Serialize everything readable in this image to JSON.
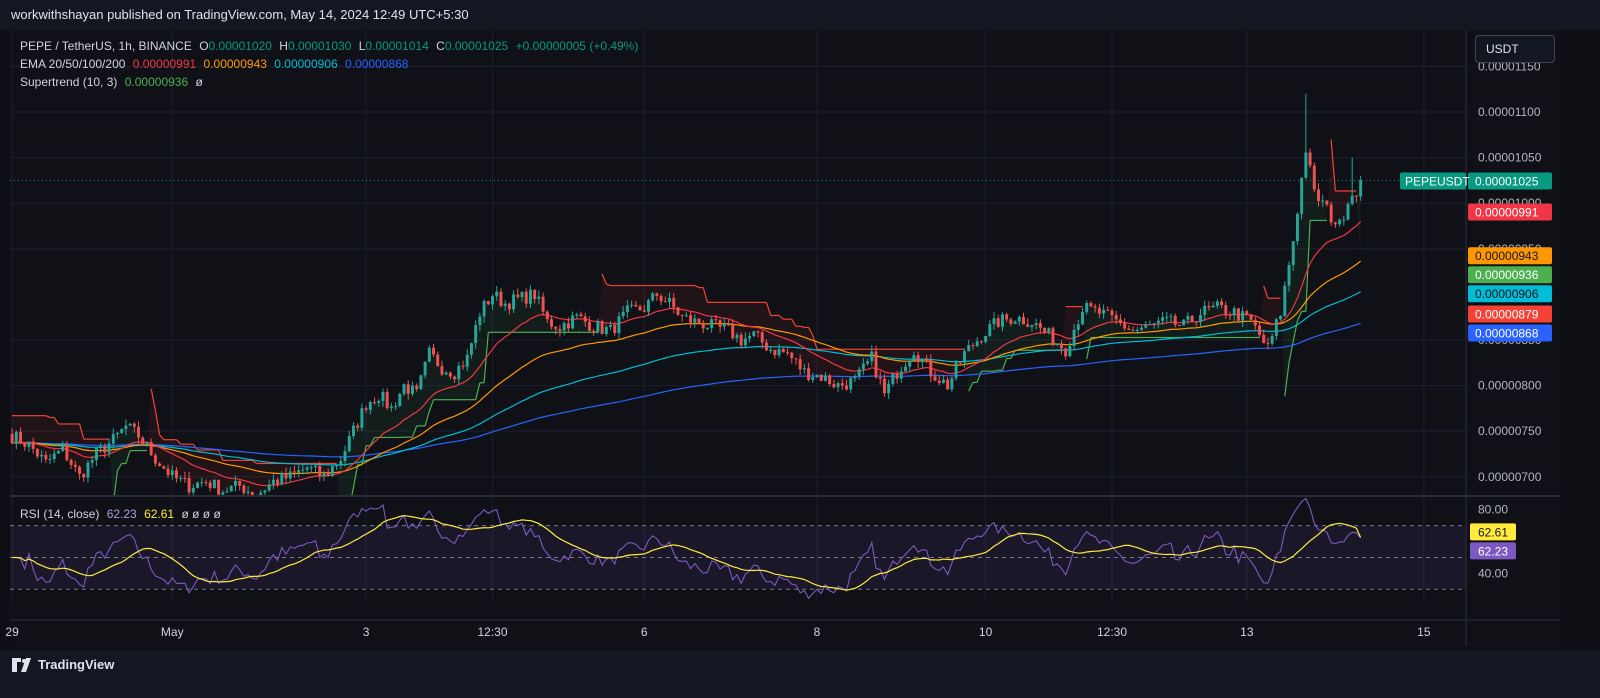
{
  "header": {
    "published": "workwithshayan published on TradingView.com, May 14, 2024 12:49 UTC+5:30"
  },
  "toolbar": {
    "currency_button": "USDT"
  },
  "brand": {
    "name": "TradingView"
  },
  "legend": {
    "symbol": "PEPE / TetherUS, 1h, BINANCE",
    "o_label": "O",
    "o_value": "0.00001020",
    "h_label": "H",
    "h_value": "0.00001030",
    "l_label": "L",
    "l_value": "0.00001014",
    "c_label": "C",
    "c_value": "0.00001025",
    "change": "+0.00000005 (+0.49%)",
    "ema_label": "EMA 20/50/100/200",
    "ema20": "0.00000991",
    "ema50": "0.00000943",
    "ema100": "0.00000906",
    "ema200": "0.00000868",
    "st_label": "Supertrend (10, 3)",
    "st_value": "0.00000936",
    "st_extra": "ø",
    "rsi_label": "RSI (14, close)",
    "rsi_value": "62.23",
    "rsi_ma": "62.61",
    "rsi_extra": "ø ø ø ø"
  },
  "colors": {
    "up": "#26a69a",
    "down": "#ef5350",
    "ema20": "#f23645",
    "ema50": "#ff9800",
    "ema100": "#00bcd4",
    "ema200": "#2962ff",
    "st_up": "#4caf50",
    "st_down": "#f44336",
    "rsi": "#7e57c2",
    "rsi_ma": "#ffeb3b",
    "price_label": "#089981"
  },
  "chart_data": {
    "type": "candlestick",
    "price_axis": {
      "ticks": [
        "0.00001150",
        "0.00001100",
        "0.00001050",
        "0.00001000",
        "0.00000950",
        "0.00000850",
        "0.00000800",
        "0.00000750",
        "0.00000700"
      ],
      "tick_values": [
        1.15e-05,
        1.1e-05,
        1.05e-05,
        1e-05,
        9.5e-06,
        8.5e-06,
        8e-06,
        7.5e-06,
        7e-06
      ],
      "ylim": [
        6.8e-06,
        1.19e-05
      ]
    },
    "price_labels": [
      {
        "name": "PEPEUSDT",
        "text": "0.00001025",
        "value": 1.025e-05,
        "color": "#089981"
      },
      {
        "text": "0.00000991",
        "value": 9.91e-06,
        "color": "#f23645"
      },
      {
        "text": "0.00000943",
        "value": 9.43e-06,
        "color": "#ff9800"
      },
      {
        "text": "0.00000936",
        "value": 9.36e-06,
        "color": "#4caf50"
      },
      {
        "text": "0.00000906",
        "value": 9.06e-06,
        "color": "#00bcd4"
      },
      {
        "text": "0.00000879",
        "value": 8.79e-06,
        "color": "#f44336"
      },
      {
        "text": "0.00000868",
        "value": 8.68e-06,
        "color": "#2962ff"
      }
    ],
    "time_axis": {
      "labels": [
        "29",
        "May",
        "3",
        "12:30",
        "6",
        "8",
        "10",
        "12:30",
        "13",
        "15"
      ],
      "label_hours": [
        0,
        38,
        84,
        114,
        150,
        191,
        231,
        261,
        293,
        335
      ]
    },
    "current_hour": 320,
    "close_anchors": [
      [
        0,
        7.45e-06
      ],
      [
        4,
        7.35e-06
      ],
      [
        8,
        7.15e-06
      ],
      [
        12,
        7.3e-06
      ],
      [
        16,
        7e-06
      ],
      [
        20,
        7.25e-06
      ],
      [
        24,
        7.4e-06
      ],
      [
        27,
        7.55e-06
      ],
      [
        30,
        7.45e-06
      ],
      [
        34,
        7.2e-06
      ],
      [
        38,
        7e-06
      ],
      [
        42,
        6.9e-06
      ],
      [
        46,
        6.95e-06
      ],
      [
        50,
        6.85e-06
      ],
      [
        54,
        6.9e-06
      ],
      [
        58,
        6.8e-06
      ],
      [
        62,
        6.95e-06
      ],
      [
        66,
        7e-06
      ],
      [
        70,
        7.1e-06
      ],
      [
        74,
        7e-06
      ],
      [
        78,
        7.2e-06
      ],
      [
        81,
        7.5e-06
      ],
      [
        84,
        7.8e-06
      ],
      [
        87,
        7.9e-06
      ],
      [
        90,
        7.75e-06
      ],
      [
        93,
        8e-06
      ],
      [
        96,
        7.9e-06
      ],
      [
        99,
        8.35e-06
      ],
      [
        102,
        8.2e-06
      ],
      [
        105,
        8.15e-06
      ],
      [
        108,
        8.3e-06
      ],
      [
        111,
        8.8e-06
      ],
      [
        114,
        9e-06
      ],
      [
        117,
        8.9e-06
      ],
      [
        120,
        8.95e-06
      ],
      [
        124,
        9e-06
      ],
      [
        127,
        8.7e-06
      ],
      [
        130,
        8.65e-06
      ],
      [
        134,
        8.75e-06
      ],
      [
        138,
        8.65e-06
      ],
      [
        142,
        8.6e-06
      ],
      [
        146,
        8.8e-06
      ],
      [
        150,
        8.85e-06
      ],
      [
        153,
        9e-06
      ],
      [
        156,
        8.9e-06
      ],
      [
        159,
        8.75e-06
      ],
      [
        162,
        8.7e-06
      ],
      [
        166,
        8.65e-06
      ],
      [
        170,
        8.6e-06
      ],
      [
        173,
        8.5e-06
      ],
      [
        176,
        8.55e-06
      ],
      [
        180,
        8.4e-06
      ],
      [
        184,
        8.35e-06
      ],
      [
        188,
        8.15e-06
      ],
      [
        192,
        8.1e-06
      ],
      [
        196,
        8e-06
      ],
      [
        200,
        8.05e-06
      ],
      [
        204,
        8.3e-06
      ],
      [
        207,
        7.9e-06
      ],
      [
        210,
        8.15e-06
      ],
      [
        214,
        8.4e-06
      ],
      [
        218,
        8.15e-06
      ],
      [
        222,
        8e-06
      ],
      [
        226,
        8.35e-06
      ],
      [
        230,
        8.55e-06
      ],
      [
        234,
        8.7e-06
      ],
      [
        238,
        8.75e-06
      ],
      [
        242,
        8.7e-06
      ],
      [
        246,
        8.55e-06
      ],
      [
        250,
        8.4e-06
      ],
      [
        254,
        8.85e-06
      ],
      [
        258,
        8.8e-06
      ],
      [
        262,
        8.7e-06
      ],
      [
        266,
        8.6e-06
      ],
      [
        270,
        8.65e-06
      ],
      [
        274,
        8.7e-06
      ],
      [
        278,
        8.65e-06
      ],
      [
        282,
        8.8e-06
      ],
      [
        286,
        8.85e-06
      ],
      [
        290,
        8.8e-06
      ],
      [
        294,
        8.7e-06
      ],
      [
        298,
        8.4e-06
      ],
      [
        301,
        8.8e-06
      ],
      [
        304,
        9.6e-06
      ],
      [
        307,
        1.06e-05
      ],
      [
        309,
        1.01e-05
      ],
      [
        311,
        1e-05
      ],
      [
        313,
        9.85e-06
      ],
      [
        315,
        9.75e-06
      ],
      [
        317,
        1.005e-05
      ],
      [
        319,
        1.015e-05
      ],
      [
        320,
        1.025e-05
      ]
    ],
    "rsi": {
      "levels": [
        70,
        50,
        30
      ],
      "tick": "40.00",
      "tick_value": 40,
      "top_tick": "80.00",
      "top_tick_value": 80,
      "ylim": [
        22,
        88
      ],
      "value": 62.23,
      "ma_value": 62.61
    }
  }
}
